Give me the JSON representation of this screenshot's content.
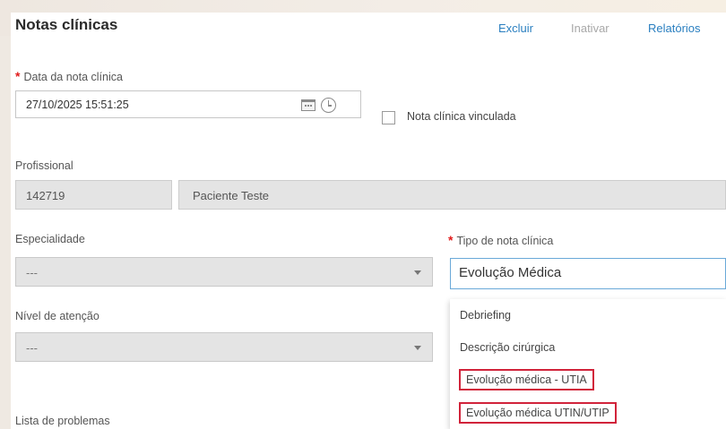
{
  "header": {
    "title": "Notas clínicas",
    "actions": {
      "excluir": "Excluir",
      "inativar": "Inativar",
      "relatorios": "Relatórios"
    }
  },
  "form": {
    "date": {
      "required_mark": "*",
      "label": "Data da nota clínica",
      "value": "27/10/2025 15:51:25"
    },
    "linked_note": {
      "label": "Nota clínica vinculada",
      "checked": false
    },
    "profissional": {
      "label": "Profissional",
      "code": "142719",
      "name": "Paciente Teste"
    },
    "especialidade": {
      "label": "Especialidade",
      "value": "---"
    },
    "tipo": {
      "required_mark": "*",
      "label": "Tipo de nota clínica",
      "value": "Evolução Médica"
    },
    "nivel": {
      "label": "Nível de atenção",
      "value": "---"
    },
    "problemas": {
      "label": "Lista de problemas"
    }
  },
  "dropdown": {
    "options": [
      "Debriefing",
      "Descrição cirúrgica",
      "Evolução médica - UTIA",
      "Evolução médica UTIN/UTIP"
    ]
  },
  "colors": {
    "link": "#2a7fc0",
    "disabled": "#a8a8a8",
    "required": "#e11b1b",
    "highlight": "#d1233a"
  }
}
